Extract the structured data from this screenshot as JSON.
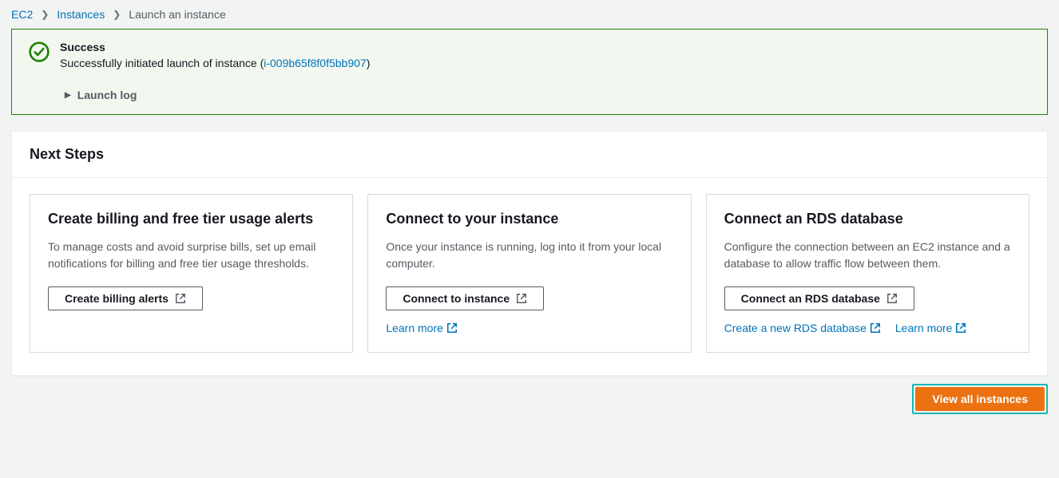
{
  "breadcrumb": {
    "items": [
      "EC2",
      "Instances",
      "Launch an instance"
    ]
  },
  "alert": {
    "title": "Success",
    "message_prefix": "Successfully initiated launch of instance (",
    "instance_id": "i-009b65f8f0f5bb907",
    "message_suffix": ")",
    "launch_log": "Launch log"
  },
  "next_steps": {
    "heading": "Next Steps",
    "cards": [
      {
        "title": "Create billing and free tier usage alerts",
        "desc": "To manage costs and avoid surprise bills, set up email notifications for billing and free tier usage thresholds.",
        "button": "Create billing alerts",
        "links": []
      },
      {
        "title": "Connect to your instance",
        "desc": "Once your instance is running, log into it from your local computer.",
        "button": "Connect to instance",
        "links": [
          "Learn more"
        ]
      },
      {
        "title": "Connect an RDS database",
        "desc": "Configure the connection between an EC2 instance and a database to allow traffic flow between them.",
        "button": "Connect an RDS database",
        "links": [
          "Create a new RDS database",
          "Learn more"
        ]
      }
    ]
  },
  "footer": {
    "view_all": "View all instances"
  }
}
